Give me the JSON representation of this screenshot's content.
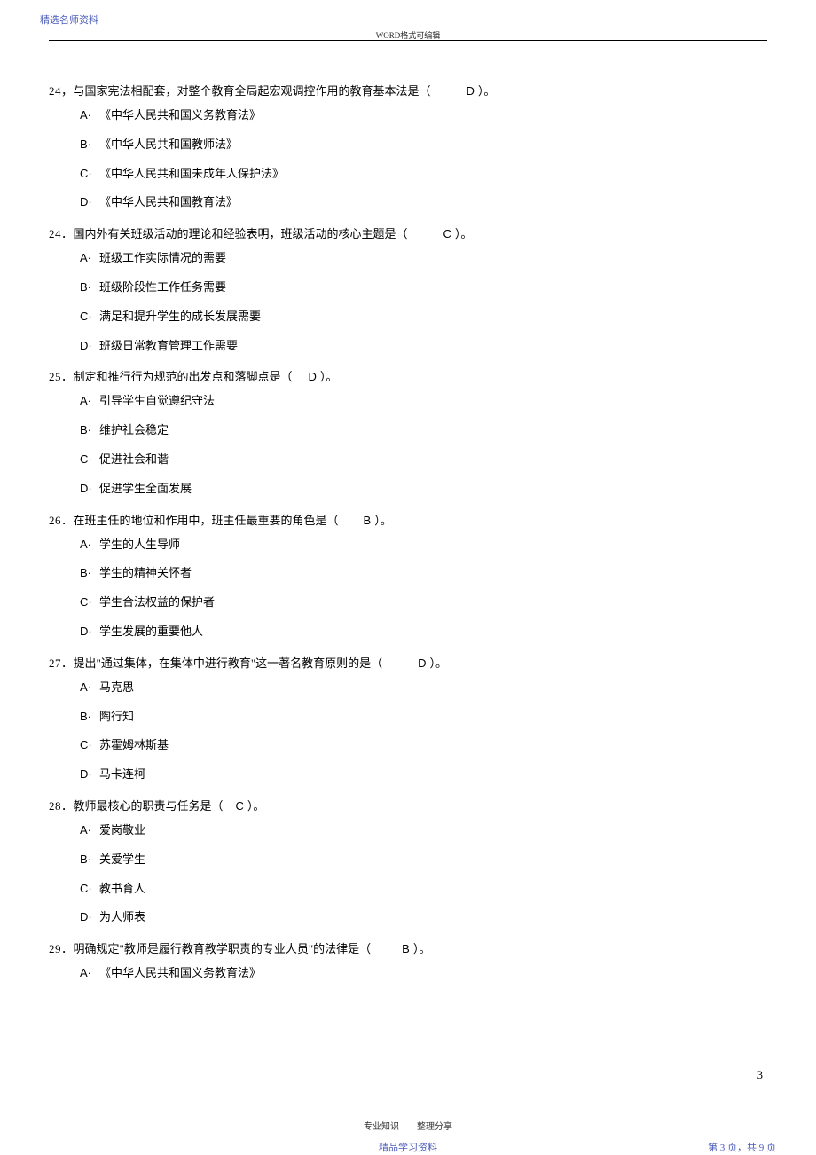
{
  "header": {
    "top_label": "精选名师资料",
    "doc_header": "WORD格式可编辑"
  },
  "questions": [
    {
      "num": "24，",
      "stem": "与国家宪法相配套，对整个教育全局起宏观调控作用的教育基本法是（",
      "answer": "D",
      "tail": "）。",
      "options": [
        {
          "label": "A·",
          "text": "《中华人民共和国义务教育法》"
        },
        {
          "label": "B·",
          "text": "《中华人民共和国教师法》"
        },
        {
          "label": "C·",
          "text": "《中华人民共和国未成年人保护法》"
        },
        {
          "label": "D·",
          "text": "《中华人民共和国教育法》"
        }
      ]
    },
    {
      "num": "24．",
      "stem": "国内外有关班级活动的理论和经验表明，班级活动的核心主题是（",
      "answer": "C",
      "tail": "）。",
      "options": [
        {
          "label": "A·",
          "text": "班级工作实际情况的需要"
        },
        {
          "label": "B·",
          "text": "班级阶段性工作任务需要"
        },
        {
          "label": "C·",
          "text": "满足和提升学生的成长发展需要"
        },
        {
          "label": "D·",
          "text": "班级日常教育管理工作需要"
        }
      ]
    },
    {
      "num": "25．",
      "stem": "制定和推行行为规范的出发点和落脚点是（",
      "answer": "D",
      "tail": "）。",
      "options": [
        {
          "label": "A·",
          "text": "引导学生自觉遵纪守法"
        },
        {
          "label": "B·",
          "text": "维护社会稳定"
        },
        {
          "label": "C·",
          "text": "促进社会和谐"
        },
        {
          "label": "D·",
          "text": "促进学生全面发展"
        }
      ]
    },
    {
      "num": "26．",
      "stem": "在班主任的地位和作用中，班主任最重要的角色是（",
      "answer": "B",
      "tail": "）。",
      "options": [
        {
          "label": "A·",
          "text": "学生的人生导师"
        },
        {
          "label": "B·",
          "text": "学生的精神关怀者"
        },
        {
          "label": "C·",
          "text": "学生合法权益的保护者"
        },
        {
          "label": "D·",
          "text": "学生发展的重要他人"
        }
      ]
    },
    {
      "num": "27．",
      "stem": "提出\"通过集体，在集体中进行教育\"这一著名教育原则的是（",
      "answer": "D",
      "tail": "）。",
      "options": [
        {
          "label": "A·",
          "text": "马克思"
        },
        {
          "label": "B·",
          "text": "陶行知"
        },
        {
          "label": "C·",
          "text": "苏霍姆林斯基"
        },
        {
          "label": "D·",
          "text": "马卡连柯"
        }
      ]
    },
    {
      "num": "28．",
      "stem": "教师最核心的职责与任务是（",
      "answer": "C",
      "tail": "）。",
      "options": [
        {
          "label": "A·",
          "text": "爱岗敬业"
        },
        {
          "label": "B·",
          "text": "关爱学生"
        },
        {
          "label": "C·",
          "text": "教书育人"
        },
        {
          "label": "D·",
          "text": "为人师表"
        }
      ]
    },
    {
      "num": "29．",
      "stem": "明确规定\"教师是履行教育教学职责的专业人员\"的法律是（",
      "answer": "B",
      "tail": "）。",
      "options": [
        {
          "label": "A·",
          "text": "《中华人民共和国义务教育法》"
        }
      ]
    }
  ],
  "page_num": "3",
  "footer": {
    "line1": "专业知识　　整理分享",
    "line2": "精品学习资料",
    "page_label": "第 3 页，共 9 页"
  }
}
